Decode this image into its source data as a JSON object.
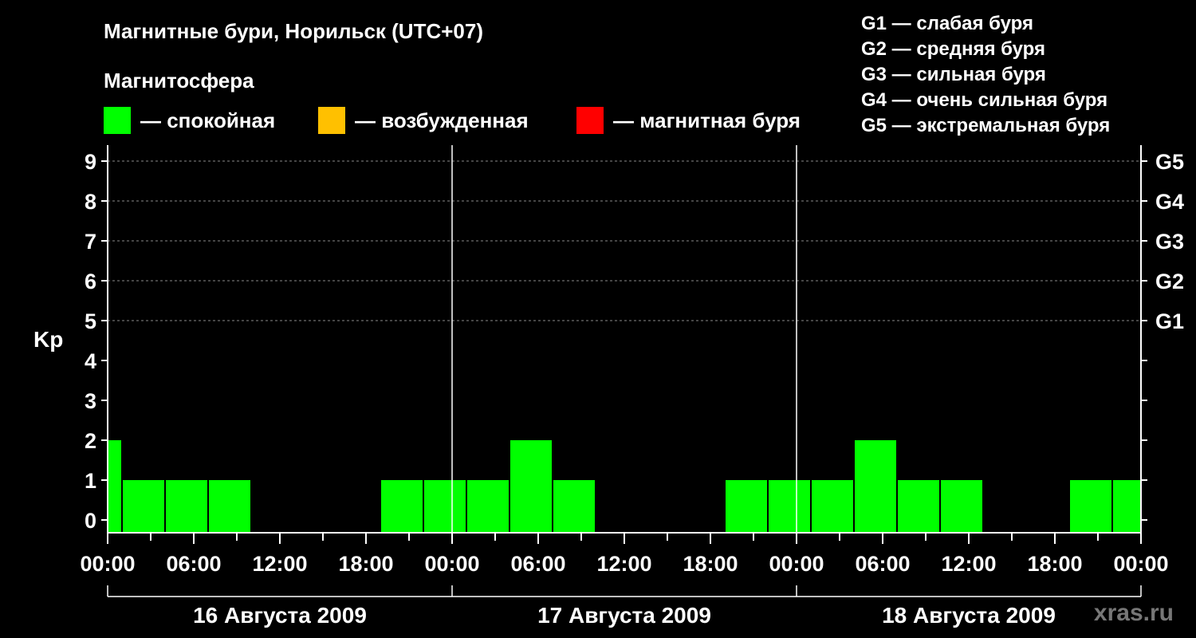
{
  "title": "Магнитные бури, Норильск (UTC+07)",
  "subtitle": "Магнитосфера",
  "legend": [
    {
      "label": "— спокойная",
      "color": "#00ff00"
    },
    {
      "label": "— возбужденная",
      "color": "#ffc000"
    },
    {
      "label": "— магнитная буря",
      "color": "#ff0000"
    }
  ],
  "g_levels": [
    "G1 — слабая буря",
    "G2 — средняя буря",
    "G3 — сильная буря",
    "G4 — очень сильная буря",
    "G5 — экстремальная буря"
  ],
  "watermark": "xras.ru",
  "chart_data": {
    "type": "bar",
    "ylabel": "Kp",
    "ylim": [
      0,
      9
    ],
    "yticks": [
      "0",
      "1",
      "2",
      "3",
      "4",
      "5",
      "6",
      "7",
      "8",
      "9"
    ],
    "right_ticks": [
      {
        "value": 5,
        "label": "G1"
      },
      {
        "value": 6,
        "label": "G2"
      },
      {
        "value": 7,
        "label": "G3"
      },
      {
        "value": 8,
        "label": "G4"
      },
      {
        "value": 9,
        "label": "G5"
      }
    ],
    "grid": "dashed horizontal at Kp 5–9",
    "xtick_labels": [
      "00:00",
      "06:00",
      "12:00",
      "18:00",
      "00:00",
      "06:00",
      "12:00",
      "18:00",
      "00:00",
      "06:00",
      "12:00",
      "18:00",
      "00:00"
    ],
    "days": [
      "16 Августа 2009",
      "17 Августа 2009",
      "18 Августа 2009"
    ],
    "bar_color": "#00ff00",
    "bars": [
      {
        "start": "16 Aug 00:00",
        "end": "16 Aug 01:00",
        "kp": 2
      },
      {
        "start": "16 Aug 01:00",
        "end": "16 Aug 04:00",
        "kp": 1
      },
      {
        "start": "16 Aug 04:00",
        "end": "16 Aug 07:00",
        "kp": 1
      },
      {
        "start": "16 Aug 07:00",
        "end": "16 Aug 10:00",
        "kp": 1
      },
      {
        "start": "16 Aug 10:00",
        "end": "16 Aug 13:00",
        "kp": 0
      },
      {
        "start": "16 Aug 13:00",
        "end": "16 Aug 16:00",
        "kp": 0
      },
      {
        "start": "16 Aug 16:00",
        "end": "16 Aug 19:00",
        "kp": 0
      },
      {
        "start": "16 Aug 19:00",
        "end": "16 Aug 22:00",
        "kp": 1
      },
      {
        "start": "16 Aug 22:00",
        "end": "17 Aug 01:00",
        "kp": 1
      },
      {
        "start": "17 Aug 01:00",
        "end": "17 Aug 04:00",
        "kp": 1
      },
      {
        "start": "17 Aug 04:00",
        "end": "17 Aug 07:00",
        "kp": 2
      },
      {
        "start": "17 Aug 07:00",
        "end": "17 Aug 10:00",
        "kp": 1
      },
      {
        "start": "17 Aug 10:00",
        "end": "17 Aug 13:00",
        "kp": 0
      },
      {
        "start": "17 Aug 13:00",
        "end": "17 Aug 16:00",
        "kp": 0
      },
      {
        "start": "17 Aug 16:00",
        "end": "17 Aug 19:00",
        "kp": 0
      },
      {
        "start": "17 Aug 19:00",
        "end": "17 Aug 22:00",
        "kp": 1
      },
      {
        "start": "17 Aug 22:00",
        "end": "18 Aug 01:00",
        "kp": 1
      },
      {
        "start": "18 Aug 01:00",
        "end": "18 Aug 04:00",
        "kp": 1
      },
      {
        "start": "18 Aug 04:00",
        "end": "18 Aug 07:00",
        "kp": 2
      },
      {
        "start": "18 Aug 07:00",
        "end": "18 Aug 10:00",
        "kp": 1
      },
      {
        "start": "18 Aug 10:00",
        "end": "18 Aug 13:00",
        "kp": 1
      },
      {
        "start": "18 Aug 13:00",
        "end": "18 Aug 16:00",
        "kp": 0
      },
      {
        "start": "18 Aug 16:00",
        "end": "18 Aug 19:00",
        "kp": 0
      },
      {
        "start": "18 Aug 19:00",
        "end": "18 Aug 22:00",
        "kp": 1
      },
      {
        "start": "18 Aug 22:00",
        "end": "19 Aug 00:00",
        "kp": 1
      }
    ]
  }
}
